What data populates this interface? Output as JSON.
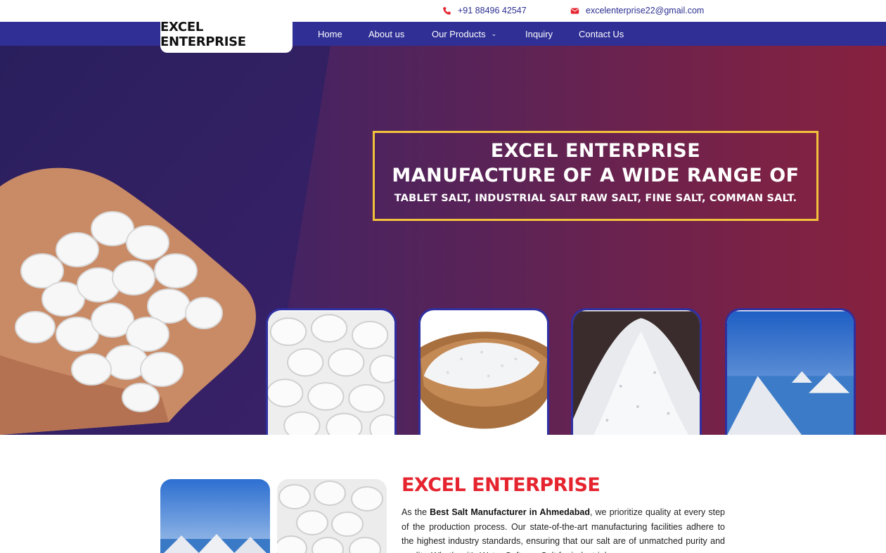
{
  "topbar": {
    "phone": "+91 88496 42547",
    "email": "excelenterprise22@gmail.com",
    "phone_icon": "phone-icon",
    "email_icon": "envelope-icon"
  },
  "brand": {
    "logo_text": "EXCEL ENTERPRISE"
  },
  "nav": {
    "home": "Home",
    "about": "About us",
    "products": "Our Products",
    "products_icon": "chevron-down-icon",
    "inquiry": "Inquiry",
    "contact": "Contact Us"
  },
  "hero": {
    "line1": "EXCEL ENTERPRISE",
    "line2": "MANUFACTURE OF A WIDE RANGE OF",
    "line3": "TABLET SALT, INDUSTRIAL SALT RAW SALT, FINE SALT, COMMAN SALT."
  },
  "about": {
    "title": "EXCEL ENTERPRISE",
    "text_pre": "As the ",
    "text_bold": "Best Salt Manufacturer in Ahmedabad",
    "text_post": ", we prioritize quality at every step of the production process. Our state-of-the-art manufacturing facilities adhere to the highest industry standards, ensuring that our salt are of unmatched purity and quality. Whether it's Water Softener Salt for industrial"
  },
  "colors": {
    "nav": "#2f2f96",
    "banner_border": "#f3c23c",
    "title_red": "#e5242f",
    "hero_left": "#2e2263",
    "hero_right": "#87213f"
  }
}
